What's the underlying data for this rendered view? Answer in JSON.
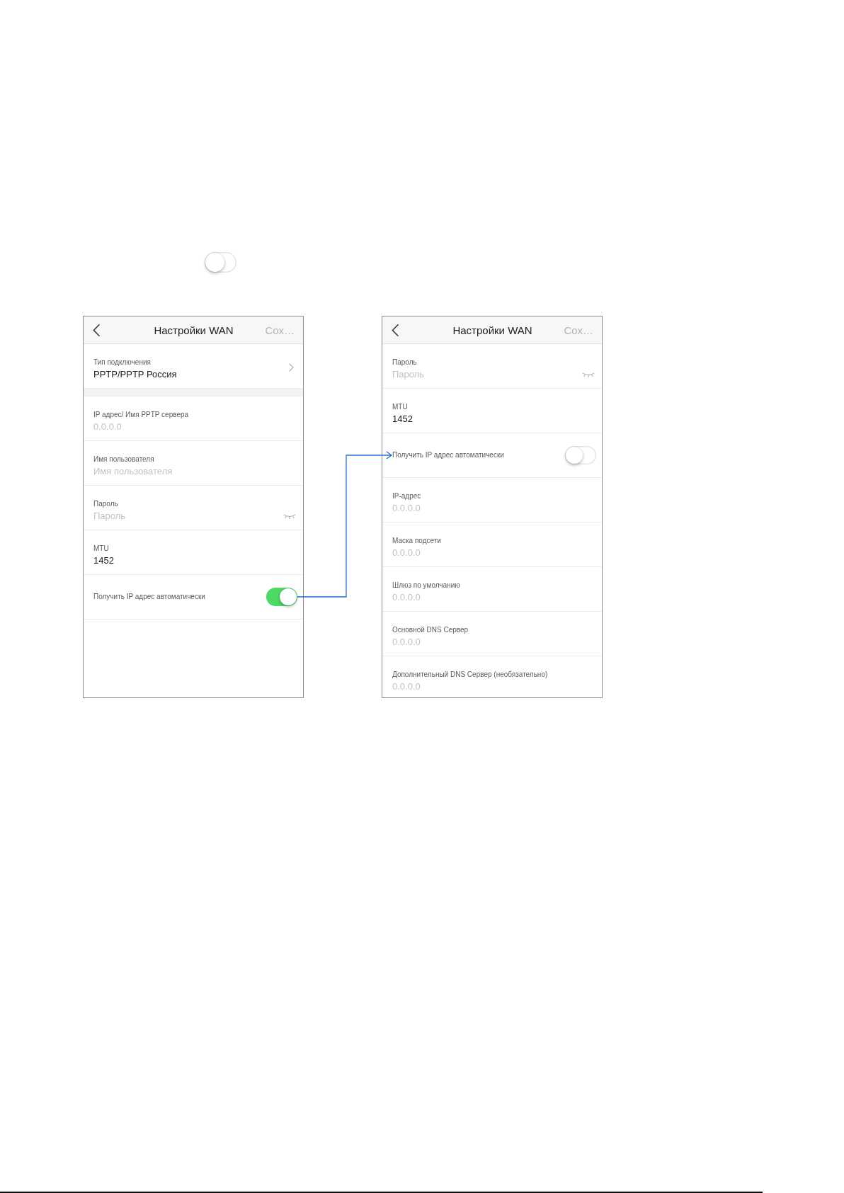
{
  "legend_toggle": {
    "on": false
  },
  "screens": [
    {
      "header": {
        "title": "Настройки WAN",
        "action": "Сох…"
      },
      "sections": [
        {
          "rows": [
            {
              "kind": "select",
              "label": "Тип подключения",
              "value": "PPTP/PPTP Россия"
            }
          ]
        },
        {
          "rows": [
            {
              "kind": "field",
              "label": "IP адрес/ Имя PPTP сервера",
              "placeholder": "0.0.0.0"
            },
            {
              "kind": "field",
              "label": "Имя пользователя",
              "placeholder": "Имя пользователя"
            },
            {
              "kind": "password",
              "label": "Пароль",
              "placeholder": "Пароль"
            },
            {
              "kind": "field",
              "label": "MTU",
              "value": "1452"
            },
            {
              "kind": "toggle",
              "label": "Получить IP адрес автоматически",
              "on": true
            }
          ]
        }
      ]
    },
    {
      "header": {
        "title": "Настройки WAN",
        "action": "Сох…"
      },
      "sections": [
        {
          "rows": [
            {
              "kind": "password",
              "label": "Пароль",
              "placeholder": "Пароль"
            },
            {
              "kind": "field",
              "label": "MTU",
              "value": "1452"
            },
            {
              "kind": "toggle",
              "label": "Получить IP адрес автоматически",
              "on": false
            },
            {
              "kind": "field",
              "label": "IP-адрес",
              "placeholder": "0.0.0.0"
            },
            {
              "kind": "field",
              "label": "Маска подсети",
              "placeholder": "0.0.0.0"
            },
            {
              "kind": "field",
              "label": "Шлюз по умолчанию",
              "placeholder": "0.0.0.0"
            },
            {
              "kind": "field",
              "label": "Основной DNS Сервер",
              "placeholder": "0.0.0.0"
            },
            {
              "kind": "field",
              "label": "Дополнительный DNS Сервер (необязательно)",
              "placeholder": "0.0.0.0"
            }
          ]
        }
      ]
    }
  ]
}
